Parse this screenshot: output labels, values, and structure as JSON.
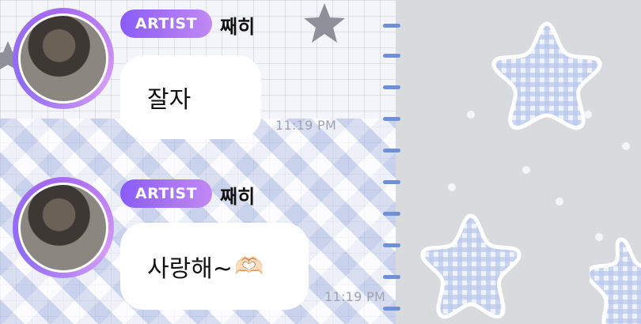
{
  "messages": [
    {
      "badge": "ARTIST",
      "sender": "째히",
      "text": "잘자",
      "emoji": "",
      "time": "11:19 PM"
    },
    {
      "badge": "ARTIST",
      "sender": "째히",
      "text": "사랑해~",
      "emoji": "🫶🏻",
      "time": "11:19 PM"
    }
  ],
  "colors": {
    "badge_start": "#8a5cf6",
    "badge_end": "#c189f3",
    "avatar_ring": "#a86bf0",
    "timestamp": "#9ea4ad",
    "bubble": "#ffffff",
    "right_panel": "#d8dadd"
  }
}
